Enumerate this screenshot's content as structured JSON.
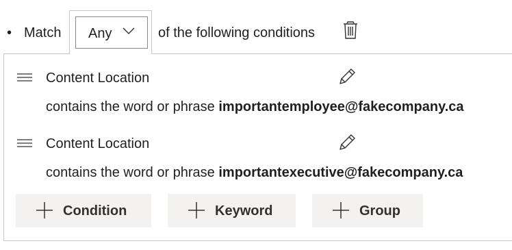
{
  "header": {
    "bullet": "•",
    "match_label": "Match",
    "select_value": "Any",
    "following_text": "of the following conditions"
  },
  "conditions": [
    {
      "title": "Content Location",
      "desc_prefix": "contains the word or phrase ",
      "desc_value": "importantemployee@fakecompany.ca"
    },
    {
      "title": "Content Location",
      "desc_prefix": "contains the word or phrase ",
      "desc_value": "importantexecutive@fakecompany.ca"
    }
  ],
  "buttons": {
    "condition": "Condition",
    "keyword": "Keyword",
    "group": "Group"
  },
  "icons": {
    "chevron": "chevron-down-icon",
    "trash": "trash-icon",
    "drag": "drag-handle-icon",
    "edit": "pencil-icon",
    "add": "plus-icon"
  },
  "colors": {
    "text": "#201f1e",
    "border": "#c8c6c4",
    "button_bg": "#f3f2f1"
  }
}
